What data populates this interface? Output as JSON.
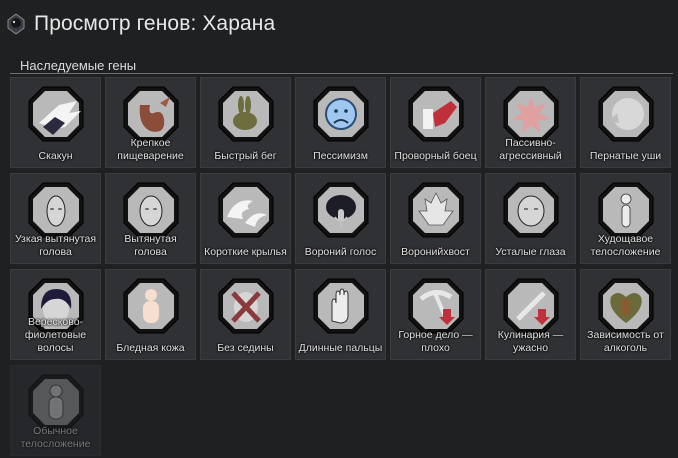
{
  "window": {
    "title": "Просмотр генов: Харана",
    "icon": "crow-head-icon"
  },
  "section": {
    "label": "Наследуемые гены"
  },
  "genes": [
    {
      "label": "Скакун",
      "icon": "winged-foot-icon",
      "hex_fill": "#b9b9b9"
    },
    {
      "label": "Крепкое пищеварение",
      "icon": "stomach-icon",
      "hex_fill": "#b9b9b9"
    },
    {
      "label": "Быстрый бег",
      "icon": "rabbit-icon",
      "hex_fill": "#b9b9b9"
    },
    {
      "label": "Пессимизм",
      "icon": "sad-face-icon",
      "hex_fill": "#b9b9b9"
    },
    {
      "label": "Проворный боец",
      "icon": "agile-fighter-icon",
      "hex_fill": "#b9b9b9"
    },
    {
      "label": "Пассивно-агрессивный",
      "icon": "burst-icon",
      "hex_fill": "#b9b9b9"
    },
    {
      "label": "Пернатые уши",
      "icon": "feathered-ears-icon",
      "hex_fill": "#b9b9b9"
    },
    {
      "label": "Узкая вытянутая голова",
      "icon": "narrow-head-icon",
      "hex_fill": "#b9b9b9"
    },
    {
      "label": "Вытянутая голова",
      "icon": "long-head-icon",
      "hex_fill": "#b9b9b9"
    },
    {
      "label": "Короткие крылья",
      "icon": "short-wings-icon",
      "hex_fill": "#b9b9b9"
    },
    {
      "label": "Вороний голос",
      "icon": "crow-voice-icon",
      "hex_fill": "#b9b9b9"
    },
    {
      "label": "Воронийхвост",
      "icon": "crow-tail-icon",
      "hex_fill": "#b9b9b9"
    },
    {
      "label": "Усталые глаза",
      "icon": "tired-eyes-icon",
      "hex_fill": "#b9b9b9"
    },
    {
      "label": "Худощавое телосложение",
      "icon": "thin-body-icon",
      "hex_fill": "#b9b9b9"
    },
    {
      "label": "Вересково-фиолетовые волосы",
      "icon": "purple-hair-icon",
      "hex_fill": "#b9b9b9"
    },
    {
      "label": "Бледная кожа",
      "icon": "pale-skin-icon",
      "hex_fill": "#b9b9b9"
    },
    {
      "label": "Без седины",
      "icon": "no-gray-hair-icon",
      "hex_fill": "#b9b9b9"
    },
    {
      "label": "Длинные пальцы",
      "icon": "long-fingers-icon",
      "hex_fill": "#b9b9b9"
    },
    {
      "label": "Горное дело — плохо",
      "icon": "mining-bad-icon",
      "hex_fill": "#b9b9b9"
    },
    {
      "label": "Кулинария — ужасно",
      "icon": "cooking-awful-icon",
      "hex_fill": "#b9b9b9"
    },
    {
      "label": "Зависимость от алкоголь",
      "icon": "alcohol-dependency-icon",
      "hex_fill": "#b9b9b9"
    },
    {
      "label": "Обычное телосложение",
      "icon": "normal-body-icon",
      "hex_fill": "#9a9a9a",
      "inactive": true
    }
  ]
}
